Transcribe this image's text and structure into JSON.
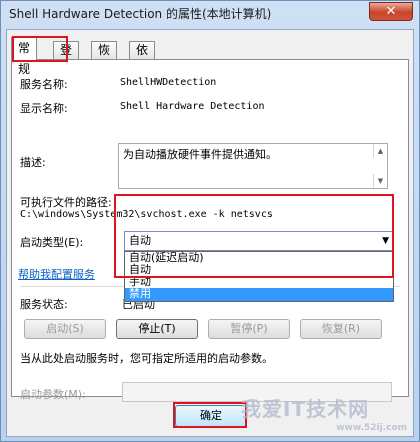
{
  "window": {
    "title": "Shell Hardware Detection 的属性(本地计算机)",
    "close_label": "✕"
  },
  "tabs": [
    {
      "label": "常规"
    },
    {
      "label": "登录"
    },
    {
      "label": "恢复"
    },
    {
      "label": "依存关系"
    }
  ],
  "general": {
    "service_name_label": "服务名称:",
    "service_name_value": "ShellHWDetection",
    "display_name_label": "显示名称:",
    "display_name_value": "Shell Hardware Detection",
    "description_label": "描述:",
    "description_value": "为自动播放硬件事件提供通知。",
    "exec_path_label": "可执行文件的路径:",
    "exec_path_value": "C:\\windows\\System32\\svchost.exe -k netsvcs",
    "startup_type_label": "启动类型(E):",
    "startup_type_selected": "自动",
    "startup_options": [
      "自动(延迟启动)",
      "自动",
      "手动",
      "禁用"
    ],
    "help_link": "帮助我配置服务",
    "service_status_label": "服务状态:",
    "service_status_value": "已启动",
    "buttons": {
      "start": "启动(S)",
      "stop": "停止(T)",
      "pause": "暂停(P)",
      "resume": "恢复(R)"
    },
    "hint_text": "当从此处启动服务时，您可指定所适用的启动参数。",
    "start_params_label": "启动参数(M):",
    "start_params_value": ""
  },
  "footer": {
    "ok_label": "确定"
  },
  "watermark": {
    "text": "我爱IT技术网",
    "url": "www.52ij.com"
  }
}
